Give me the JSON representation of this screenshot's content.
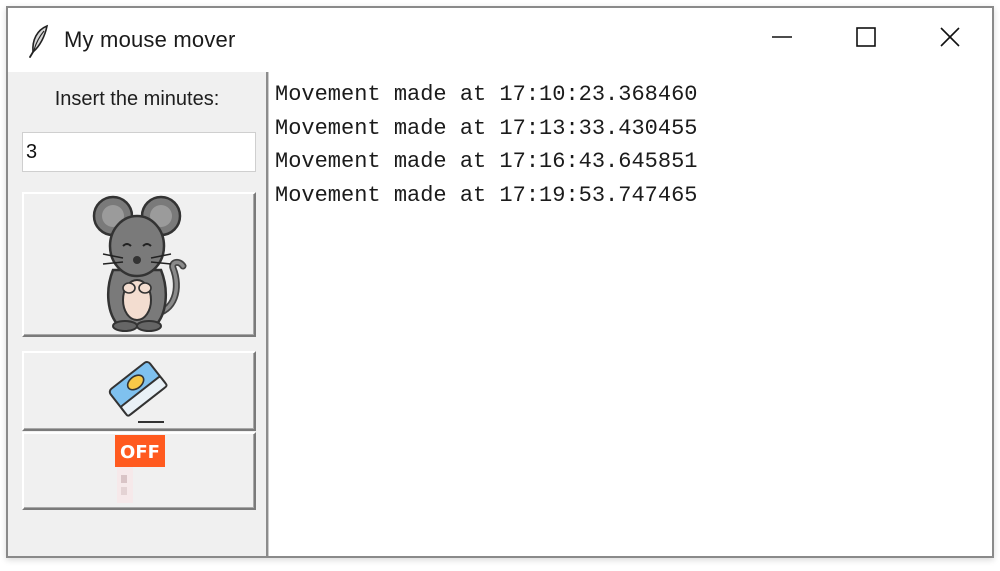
{
  "window": {
    "title": "My mouse mover",
    "icon": "feather-icon",
    "controls": [
      "minimize-icon",
      "maximize-icon",
      "close-icon"
    ]
  },
  "left_panel": {
    "minutes_label": "Insert the minutes:",
    "minutes_value": "3",
    "buttons": [
      {
        "name": "start-mouse-mover",
        "icon": "mouse-icon"
      },
      {
        "name": "clear-log",
        "icon": "eraser-icon"
      },
      {
        "name": "turn-off",
        "icon": "off-icon",
        "badge_text": "OFF"
      }
    ]
  },
  "log": {
    "lines": [
      "Movement made at 17:10:23.368460",
      "Movement made at 17:13:33.430455",
      "Movement made at 17:16:43.645851",
      "Movement made at 17:19:53.747465"
    ]
  },
  "colors": {
    "window_bg": "#f0f0f0",
    "log_bg": "#ffffff",
    "off_badge": "#ff5a1f",
    "mouse_body": "#7a7a7a",
    "eraser_blue": "#7fc1ef"
  }
}
